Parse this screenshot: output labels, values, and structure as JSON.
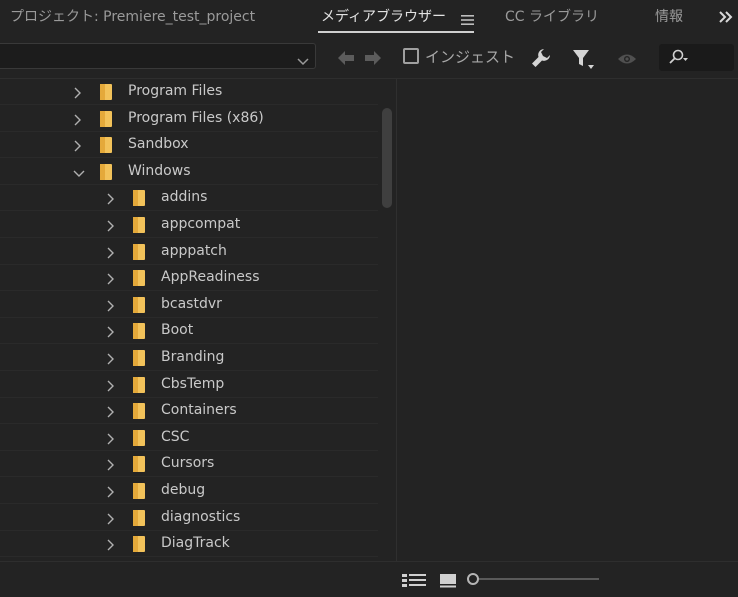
{
  "tabs": [
    {
      "label": "プロジェクト: Premiere_test_project"
    },
    {
      "label": "メディアブラウザー"
    },
    {
      "label": "CC ライブラリ"
    },
    {
      "label": "情報"
    }
  ],
  "toolbar": {
    "ingest_label": "インジェスト",
    "ingest_checked": false,
    "path_value": ""
  },
  "tree": {
    "items": [
      {
        "label": "Program Files",
        "level": 1,
        "expanded": false
      },
      {
        "label": "Program Files (x86)",
        "level": 1,
        "expanded": false
      },
      {
        "label": "Sandbox",
        "level": 1,
        "expanded": false
      },
      {
        "label": "Windows",
        "level": 1,
        "expanded": true
      },
      {
        "label": "addins",
        "level": 2,
        "expanded": false
      },
      {
        "label": "appcompat",
        "level": 2,
        "expanded": false
      },
      {
        "label": "apppatch",
        "level": 2,
        "expanded": false
      },
      {
        "label": "AppReadiness",
        "level": 2,
        "expanded": false
      },
      {
        "label": "bcastdvr",
        "level": 2,
        "expanded": false
      },
      {
        "label": "Boot",
        "level": 2,
        "expanded": false
      },
      {
        "label": "Branding",
        "level": 2,
        "expanded": false
      },
      {
        "label": "CbsTemp",
        "level": 2,
        "expanded": false
      },
      {
        "label": "Containers",
        "level": 2,
        "expanded": false
      },
      {
        "label": "CSC",
        "level": 2,
        "expanded": false
      },
      {
        "label": "Cursors",
        "level": 2,
        "expanded": false
      },
      {
        "label": "debug",
        "level": 2,
        "expanded": false
      },
      {
        "label": "diagnostics",
        "level": 2,
        "expanded": false
      },
      {
        "label": "DiagTrack",
        "level": 2,
        "expanded": false
      }
    ]
  },
  "icons": {
    "folder_color": "#f2c25a",
    "tab_menu": "hamburger-icon",
    "overflow": "double-chevron-right-icon"
  }
}
